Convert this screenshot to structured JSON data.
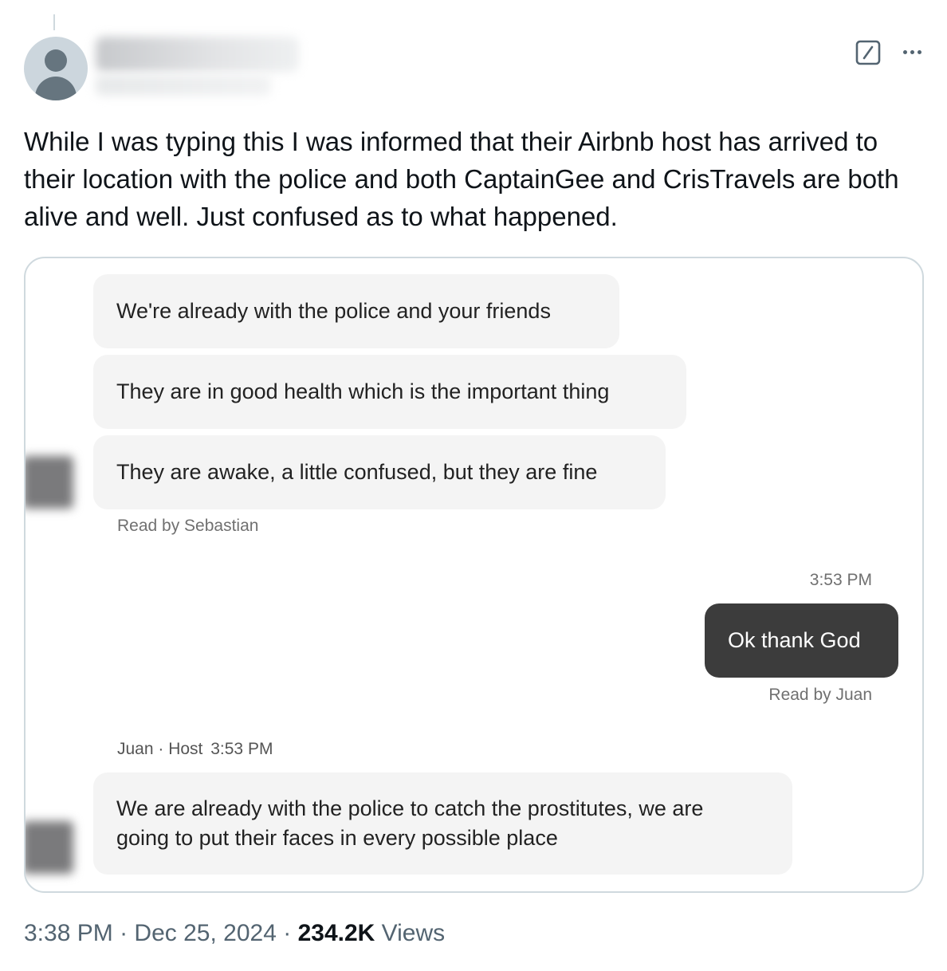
{
  "tweet": {
    "text": "While I was typing this I was informed that their Airbnb host has arrived to their location with the police and both CaptainGee and CrisTravels are both alive and well. Just confused as to what happened.",
    "icons": {
      "grok": "grok-icon",
      "more": "more-icon",
      "avatar": "default-avatar-icon"
    }
  },
  "chat": {
    "messages": [
      {
        "text": "We're already with the police and your friends"
      },
      {
        "text": "They are in good health which is the important thing"
      },
      {
        "text": "They are awake, a little confused, but they are fine"
      }
    ],
    "read_by_1": "Read by Sebastian",
    "own_time": "3:53 PM",
    "own_message": "Ok thank God",
    "read_by_2": "Read by Juan",
    "host_label": "Juan · Host",
    "host_time": "3:53 PM",
    "host_message": "We are already with the police to catch the prostitutes, we are going to put their faces in every possible place"
  },
  "footer": {
    "time": "3:38 PM",
    "sep1": "·",
    "date": "Dec 25, 2024",
    "sep2": "·",
    "views_count": "234.2K",
    "views_label": "Views"
  },
  "colors": {
    "text": "#0f1419",
    "muted": "#536471",
    "bubble": "#f4f4f4",
    "own_bubble": "#3c3c3c",
    "border": "#cfd9de"
  }
}
